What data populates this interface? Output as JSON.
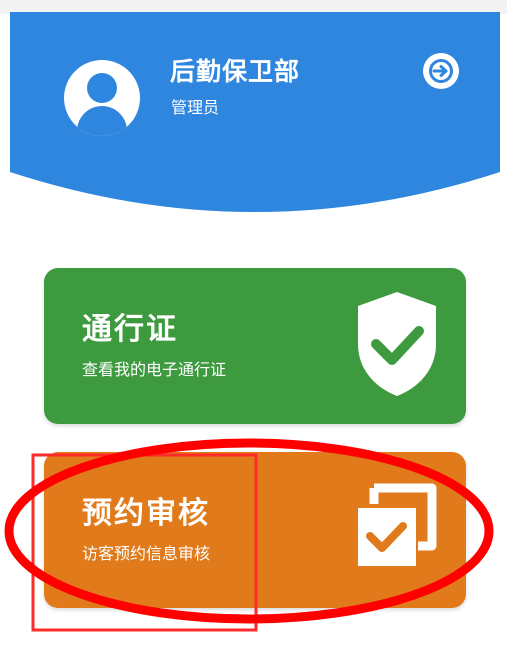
{
  "header": {
    "user_name": "后勤保卫部",
    "user_role": "管理员",
    "background_color": "#2f86df",
    "avatar_icon": "user-avatar-icon",
    "logout_icon": "logout-icon"
  },
  "cards": [
    {
      "title": "通行证",
      "subtitle": "查看我的电子通行证",
      "color": "#3e9a3f",
      "icon": "shield-check-icon"
    },
    {
      "title": "预约审核",
      "subtitle": "访客预约信息审核",
      "color": "#e07a1b",
      "icon": "copy-check-icon"
    }
  ],
  "annotations": {
    "ellipse_color": "#ff0000",
    "rectangle_color": "#ff2a2a"
  }
}
